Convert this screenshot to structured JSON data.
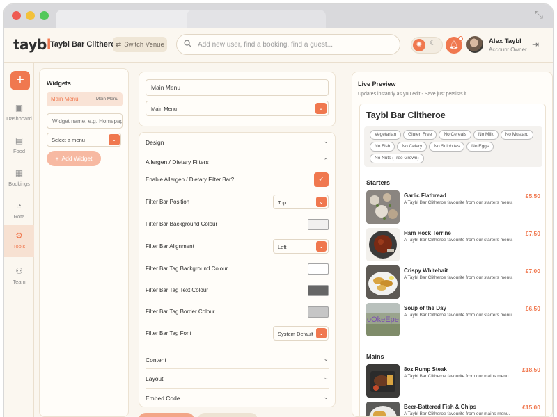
{
  "app": {
    "logo": {
      "main": "tayb",
      "accent": "l"
    },
    "venue_name": "Taybl Bar Clitheroe",
    "switch_venue_label": "Switch Venue",
    "search_placeholder": "Add new user, find a booking, find a guest...",
    "user": {
      "name": "Alex Taybl",
      "role": "Account Owner"
    }
  },
  "colors": {
    "accent": "#f0784f",
    "background": "#faf6ef"
  },
  "sidebar": {
    "items": [
      {
        "label": "Dashboard",
        "icon": "dashboard-icon"
      },
      {
        "label": "Food",
        "icon": "food-icon"
      },
      {
        "label": "Bookings",
        "icon": "calendar-icon"
      },
      {
        "label": "Rota",
        "icon": "rota-icon"
      },
      {
        "label": "Tools",
        "icon": "tools-icon",
        "active": true
      },
      {
        "label": "Team",
        "icon": "team-icon"
      }
    ]
  },
  "widgets": {
    "title": "Widgets",
    "items": [
      {
        "name": "Main Menu",
        "type": "Main Menu"
      }
    ],
    "name_placeholder": "Widget name, e.g. Homepage",
    "select_label": "Select a menu",
    "add_label": "Add Widget"
  },
  "editor": {
    "widget_name": "Main Menu",
    "menu_select": "Main Menu",
    "sections": {
      "design": "Design",
      "allergen": "Allergen / Dietary Filters",
      "content": "Content",
      "layout": "Layout",
      "embed": "Embed Code"
    },
    "fields": {
      "enable": "Enable Allergen / Dietary Filter Bar?",
      "position": {
        "label": "Filter Bar Position",
        "value": "Top"
      },
      "bg_colour": {
        "label": "Filter Bar Background Colour",
        "color": "#f1f0ef"
      },
      "alignment": {
        "label": "Filter Bar Alignment",
        "value": "Left"
      },
      "tag_bg": {
        "label": "Filter Bar Tag Background Colour",
        "color": "#ffffff"
      },
      "tag_text": {
        "label": "Filter Bar Tag Text Colour",
        "color": "#666666"
      },
      "tag_border": {
        "label": "Filter Bar Tag Border Colour",
        "color": "#c6c6c6"
      },
      "tag_font": {
        "label": "Filter Bar Tag Font",
        "value": "System Default"
      }
    }
  },
  "preview": {
    "title": "Live Preview",
    "subtitle": "Updates instantly as you edit - Save just persists it.",
    "venue": "Taybl Bar Clitheroe",
    "tags": [
      "Vegetarian",
      "Gluten Free",
      "No Cereals",
      "No Milk",
      "No Mustard",
      "No Fish",
      "No Celery",
      "No Sulphites",
      "No Eggs",
      "No Nuts (Tree Grown)"
    ],
    "categories": [
      {
        "name": "Starters",
        "items": [
          {
            "name": "Garlic Flatbread",
            "desc": "A Taybl Bar Clitheroe favourite from our starters menu.",
            "price": "£5.50"
          },
          {
            "name": "Ham Hock Terrine",
            "desc": "A Taybl Bar Clitheroe favourite from our starters menu.",
            "price": "£7.50"
          },
          {
            "name": "Crispy Whitebait",
            "desc": "A Taybl Bar Clitheroe favourite from our starters menu.",
            "price": "£7.00"
          },
          {
            "name": "Soup of the Day",
            "desc": "A Taybl Bar Clitheroe favourite from our starters menu.",
            "price": "£6.50",
            "image_text": "oOkeEpe"
          }
        ]
      },
      {
        "name": "Mains",
        "items": [
          {
            "name": "8oz Rump Steak",
            "desc": "A Taybl Bar Clitheroe favourite from our mains menu.",
            "price": "£18.50"
          },
          {
            "name": "Beer-Battered Fish & Chips",
            "desc": "A Taybl Bar Clitheroe favourite from our mains menu.",
            "price": "£15.00"
          }
        ]
      }
    ]
  }
}
